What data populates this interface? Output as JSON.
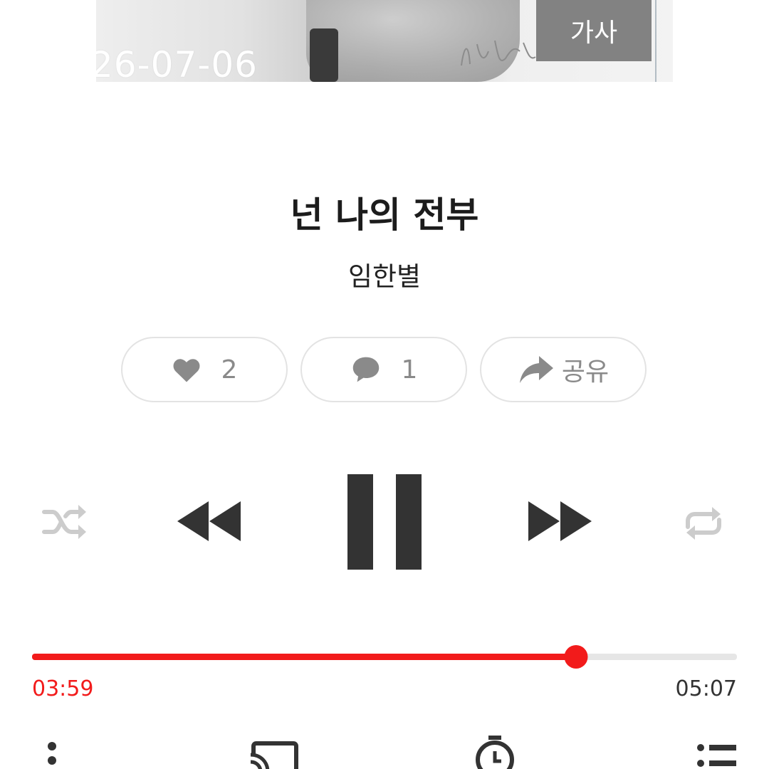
{
  "album": {
    "date_overlay": "26-07-06",
    "lyrics_label": "가사"
  },
  "track": {
    "title": "넌 나의 전부",
    "artist": "임한별"
  },
  "actions": {
    "like_count": "2",
    "comment_count": "1",
    "share_label": "공유"
  },
  "playback": {
    "state": "playing",
    "elapsed": "03:59",
    "total": "05:07",
    "progress_fraction": 0.772,
    "shuffle": "off",
    "repeat": "off"
  },
  "colors": {
    "accent": "#f21b1b",
    "control": "#333333",
    "inactive": "#cccccc",
    "pill_border": "#e3e3e3"
  },
  "icons": [
    "heart-icon",
    "comment-icon",
    "share-icon",
    "shuffle-icon",
    "rewind-icon",
    "pause-icon",
    "fast-forward-icon",
    "repeat-icon",
    "more-icon",
    "cast-icon",
    "timer-icon",
    "playlist-icon"
  ]
}
